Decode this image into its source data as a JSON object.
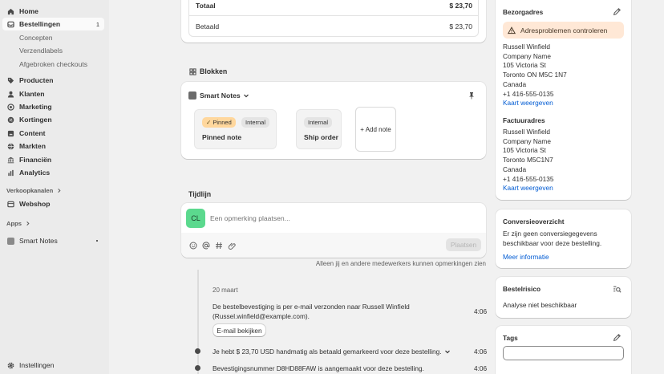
{
  "sidebar": {
    "items": [
      {
        "label": "Home",
        "icon": "home-icon"
      },
      {
        "label": "Bestellingen",
        "icon": "inbox-icon",
        "badge": "1"
      },
      {
        "label": "Producten",
        "icon": "tag-icon"
      },
      {
        "label": "Klanten",
        "icon": "person-icon"
      },
      {
        "label": "Marketing",
        "icon": "target-icon"
      },
      {
        "label": "Kortingen",
        "icon": "discount-icon"
      },
      {
        "label": "Content",
        "icon": "content-icon"
      },
      {
        "label": "Markten",
        "icon": "globe-icon"
      },
      {
        "label": "Financiën",
        "icon": "bank-icon"
      },
      {
        "label": "Analytics",
        "icon": "chart-icon"
      }
    ],
    "subitems": [
      "Concepten",
      "Verzendlabels",
      "Afgebroken checkouts"
    ],
    "sales_channels_label": "Verkoopkanalen",
    "webshop_label": "Webshop",
    "apps_label": "Apps",
    "smart_notes_label": "Smart Notes",
    "settings_label": "Instellingen"
  },
  "totals": {
    "total_label": "Totaal",
    "total_value": "$ 23,70",
    "paid_label": "Betaald",
    "paid_value": "$ 23,70"
  },
  "blocks": {
    "title": "Blokken",
    "app_name": "Smart Notes",
    "notes": [
      {
        "tags": [
          "Pinned",
          "Internal"
        ],
        "title": "Pinned note"
      },
      {
        "tags": [
          "Internal"
        ],
        "title": "Ship order"
      }
    ],
    "add_note_label": "+ Add note"
  },
  "timeline": {
    "title": "Tijdlijn",
    "avatar_initials": "CL",
    "comment_placeholder": "Een opmerking plaatsen...",
    "post_label": "Plaatsen",
    "privacy_note": "Alleen jij en andere medewerkers kunnen opmerkingen zien",
    "date": "20 maart",
    "events": [
      {
        "text": "De bestelbevestiging is per e-mail verzonden naar Russell Winfield (Russel.winfield@example.com).",
        "time": "4:06",
        "button": "E-mail bekijken"
      },
      {
        "text": "Je hebt $ 23,70 USD handmatig als betaald gemarkeerd voor deze bestelling.",
        "time": "4:06"
      },
      {
        "text": "Bevestigingsnummer D8HD88FAW is aangemaakt voor deze bestelling.",
        "time": "4:06"
      }
    ]
  },
  "shipping": {
    "title": "Bezorgadres",
    "warning": "Adresproblemen controleren",
    "lines": [
      "Russell Winfield",
      "Company Name",
      "105 Victoria St",
      "Toronto ON M5C 1N7",
      "Canada",
      "+1 416-555-0135"
    ],
    "map_link": "Kaart weergeven"
  },
  "billing": {
    "title": "Factuuradres",
    "lines": [
      "Russell Winfield",
      "Company Name",
      "105 Victoria St",
      "Toronto M5C1N7",
      "Canada",
      "+1 416-555-0135"
    ],
    "map_link": "Kaart weergeven"
  },
  "conversion": {
    "title": "Conversieoverzicht",
    "text": "Er zijn geen conversiegegevens beschikbaar voor deze bestelling.",
    "link": "Meer informatie"
  },
  "risk": {
    "title": "Bestelrisico",
    "text": "Analyse niet beschikbaar"
  },
  "tags": {
    "title": "Tags",
    "input_value": ""
  },
  "colors": {
    "accent_link": "#005bd3",
    "warning_bg": "#ffe8d6",
    "pinned_bg": "#ffdca8",
    "avatar_bg": "#5bd98e"
  }
}
